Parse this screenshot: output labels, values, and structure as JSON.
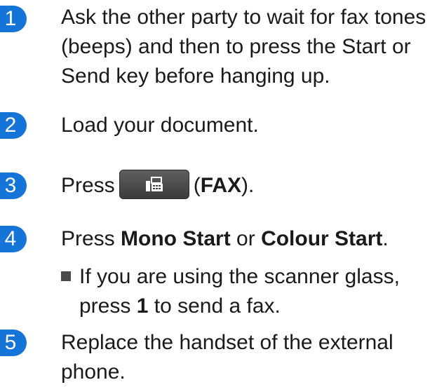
{
  "steps": [
    {
      "number": "1",
      "text": "Ask the other party to wait for fax tones (beeps) and then to press the Start or Send key before hanging up."
    },
    {
      "number": "2",
      "text": "Load your document."
    },
    {
      "number": "3",
      "prefix": "Press",
      "key_suffix_open": "(",
      "key_label": "FAX",
      "key_suffix_close": ")."
    },
    {
      "number": "4",
      "prefix": "Press",
      "strong1": "Mono Start",
      "mid": "or",
      "strong2": "Colour Start",
      "end": "."
    },
    {
      "number": "5",
      "text": "Replace the handset of the external phone."
    }
  ],
  "substep": {
    "line1": "If you are using the scanner glass,",
    "line2_pre": "press",
    "line2_strong": "1",
    "line2_post": "to send a fax."
  },
  "colors": {
    "badge": "#1574d8"
  }
}
